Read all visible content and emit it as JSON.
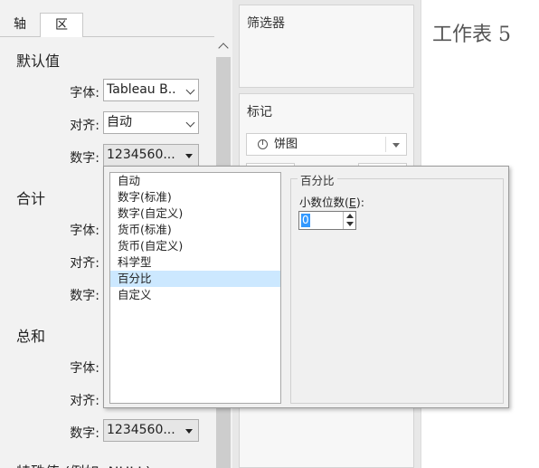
{
  "tabs": {
    "axis": "轴",
    "pane": "区"
  },
  "sections": {
    "default": {
      "title": "默认值",
      "font_label": "字体:",
      "font_value": "Tableau B..",
      "align_label": "对齐:",
      "align_value": "自动",
      "number_label": "数字:",
      "number_value": "1234560..."
    },
    "totals": {
      "title": "合计",
      "font_label": "字体:",
      "align_label": "对齐:",
      "number_label": "数字:"
    },
    "grand_totals": {
      "title": "总和",
      "font_label": "字体:",
      "align_label": "对齐:",
      "number_label": "数字:",
      "number_value": "1234560..."
    },
    "special_values": {
      "title": "特殊值 (例如, NULL)"
    }
  },
  "filters": {
    "title": "筛选器"
  },
  "marks": {
    "title": "标记",
    "mark_type": "饼图",
    "mark_icon": "pie-chart-icon"
  },
  "sheet": {
    "title": "工作表 5"
  },
  "number_format_popup": {
    "formats": [
      "自动",
      "数字(标准)",
      "数字(自定义)",
      "货币(标准)",
      "货币(自定义)",
      "科学型",
      "百分比",
      "自定义"
    ],
    "selected": "百分比",
    "group_title": "百分比",
    "decimal_label": "小数位数",
    "decimal_hotkey": "E",
    "decimal_value": "0"
  },
  "colors": {
    "selection": "#cce8ff",
    "text_highlight": "#3399ff",
    "pane_bg": "#f2f2f2"
  }
}
